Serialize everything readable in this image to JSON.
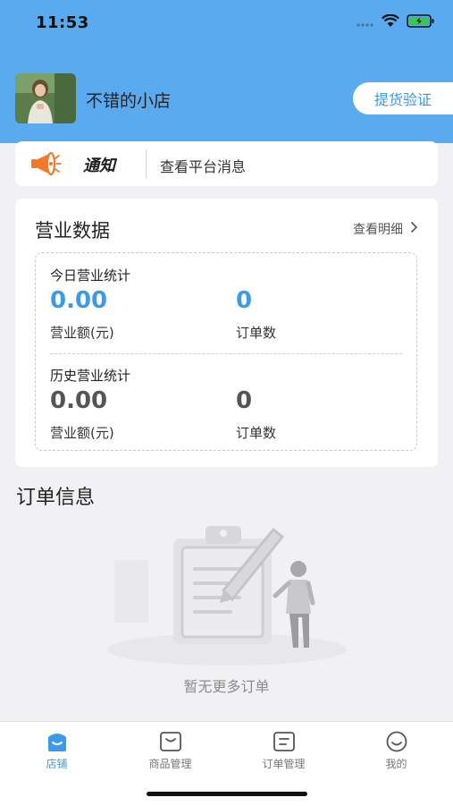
{
  "status_bar": {
    "time": "11:53"
  },
  "store": {
    "name": "不错的小店",
    "pickup_button": "提货验证"
  },
  "notice": {
    "title": "通知",
    "text": "查看平台消息"
  },
  "business": {
    "title": "营业数据",
    "detail_link": "查看明细",
    "today": {
      "label": "今日营业统计",
      "revenue": "0.00",
      "revenue_label": "营业额(元)",
      "orders": "0",
      "orders_label": "订单数"
    },
    "history": {
      "label": "历史营业统计",
      "revenue": "0.00",
      "revenue_label": "营业额(元)",
      "orders": "0",
      "orders_label": "订单数"
    }
  },
  "orders": {
    "title": "订单信息",
    "empty_text": "暂无更多订单"
  },
  "tabbar": {
    "tabs": [
      {
        "label": "店铺",
        "icon": "store-icon",
        "active": true
      },
      {
        "label": "商品管理",
        "icon": "goods-icon",
        "active": false
      },
      {
        "label": "订单管理",
        "icon": "orders-icon",
        "active": false
      },
      {
        "label": "我的",
        "icon": "profile-icon",
        "active": false
      }
    ]
  },
  "colors": {
    "header": "#5aaaf0",
    "accent": "#3d9ae8",
    "background": "#f1f1f3"
  }
}
